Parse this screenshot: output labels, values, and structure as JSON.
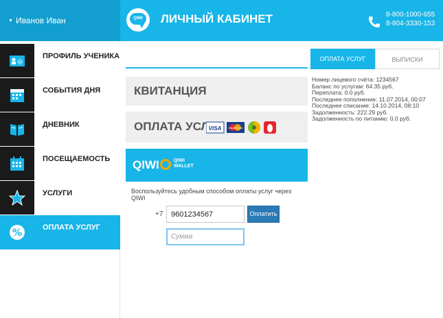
{
  "header": {
    "user_name": "Иванов Иван",
    "logo_text": "QIWI",
    "title": "ЛИЧНЫЙ КАБИНЕТ",
    "phone_1": "8-800-1000-655",
    "phone_2": "8-804-3330-153"
  },
  "sidebar": {
    "items": [
      {
        "label": "ПРОФИЛЬ УЧЕНИКА",
        "icon": "id-card-icon"
      },
      {
        "label": "СОБЫТИЯ ДНЯ",
        "icon": "calendar-events-icon"
      },
      {
        "label": "ДНЕВНИК",
        "icon": "book-icon"
      },
      {
        "label": "ПОСЕЩАЕМОСТЬ",
        "icon": "calendar-grid-icon"
      },
      {
        "label": "УСЛУГИ",
        "icon": "star-icon"
      },
      {
        "label": "ОПЛАТА УСЛУГ",
        "icon": "percent-icon"
      }
    ],
    "active_index": 5
  },
  "main": {
    "receipt_title": "КВИТАНЦИЯ",
    "payment_title": "ОПЛАТА УСЛУГ",
    "card_labels": [
      "VISA",
      "MasterCard"
    ],
    "qiwi": {
      "title": "QIWI",
      "wallet_line_1": "QIWI",
      "wallet_line_2": "WALLET",
      "description": "Воспользуйтесь удобным способом оплаты услуг через QIWI",
      "phone_prefix": "+7",
      "phone_value": "9601234567",
      "pay_button": "Оплатить",
      "sum_placeholder": "Сумма"
    }
  },
  "right_panel": {
    "tabs": [
      {
        "label": "ОПЛАТА УСЛУГ",
        "active": true
      },
      {
        "label": "ВЫПИСКИ",
        "active": false
      }
    ],
    "info": [
      "Номер лицевого счёта: 1234567",
      "Баланс по услугам: 64.35 руб.",
      "Переплата: 0.0 руб.",
      "Последнее пополнение: 11.07.2014, 00:07",
      "Последнее списание: 14.10.2014, 08:10",
      "Задолженность: 222.29 руб.",
      "Задолженность по питанию: 0.0 руб."
    ]
  },
  "colors": {
    "accent": "#17b5e8",
    "accent_dark": "#129fcf",
    "button": "#2a7ab6"
  }
}
